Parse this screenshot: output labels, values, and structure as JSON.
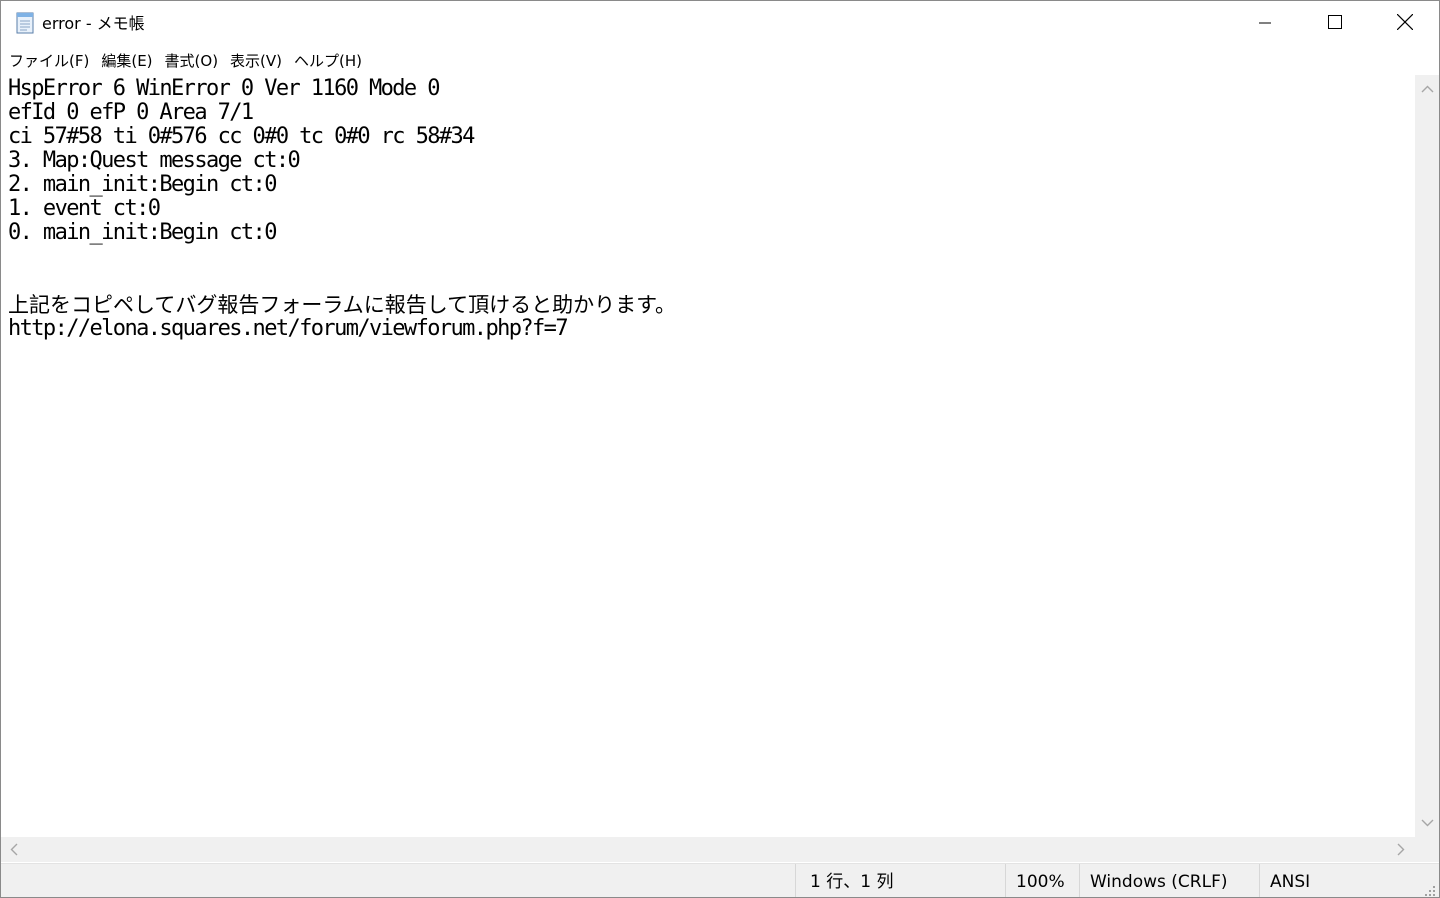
{
  "window": {
    "title": "error - メモ帳"
  },
  "menu": [
    {
      "label": "ファイル(F)"
    },
    {
      "label": "編集(E)"
    },
    {
      "label": "書式(O)"
    },
    {
      "label": "表示(V)"
    },
    {
      "label": "ヘルプ(H)"
    }
  ],
  "editor": {
    "lines": [
      "HspError 6 WinError 0 Ver 1160 Mode 0",
      "efId 0 efP 0 Area 7/1",
      "ci 57#58 ti 0#576 cc 0#0 tc 0#0 rc 58#34",
      "3. Map:Quest message ct:0",
      "2. main_init:Begin ct:0",
      "1. event ct:0",
      "0. main_init:Begin ct:0",
      "",
      "",
      "上記をコピペしてバグ報告フォーラムに報告して頂けると助かります。",
      "http://elona.squares.net/forum/viewforum.php?f=7"
    ]
  },
  "status": {
    "position": "1 行、1 列",
    "zoom": "100%",
    "line_ending": "Windows (CRLF)",
    "encoding": "ANSI"
  },
  "icons": {
    "app": "notepad-icon",
    "minimize": "minimize-icon",
    "maximize": "maximize-icon",
    "close": "close-icon"
  },
  "colors": {
    "chrome": "#f0f0f0",
    "text": "#000000",
    "scroll_arrow": "#a6a6a6"
  }
}
